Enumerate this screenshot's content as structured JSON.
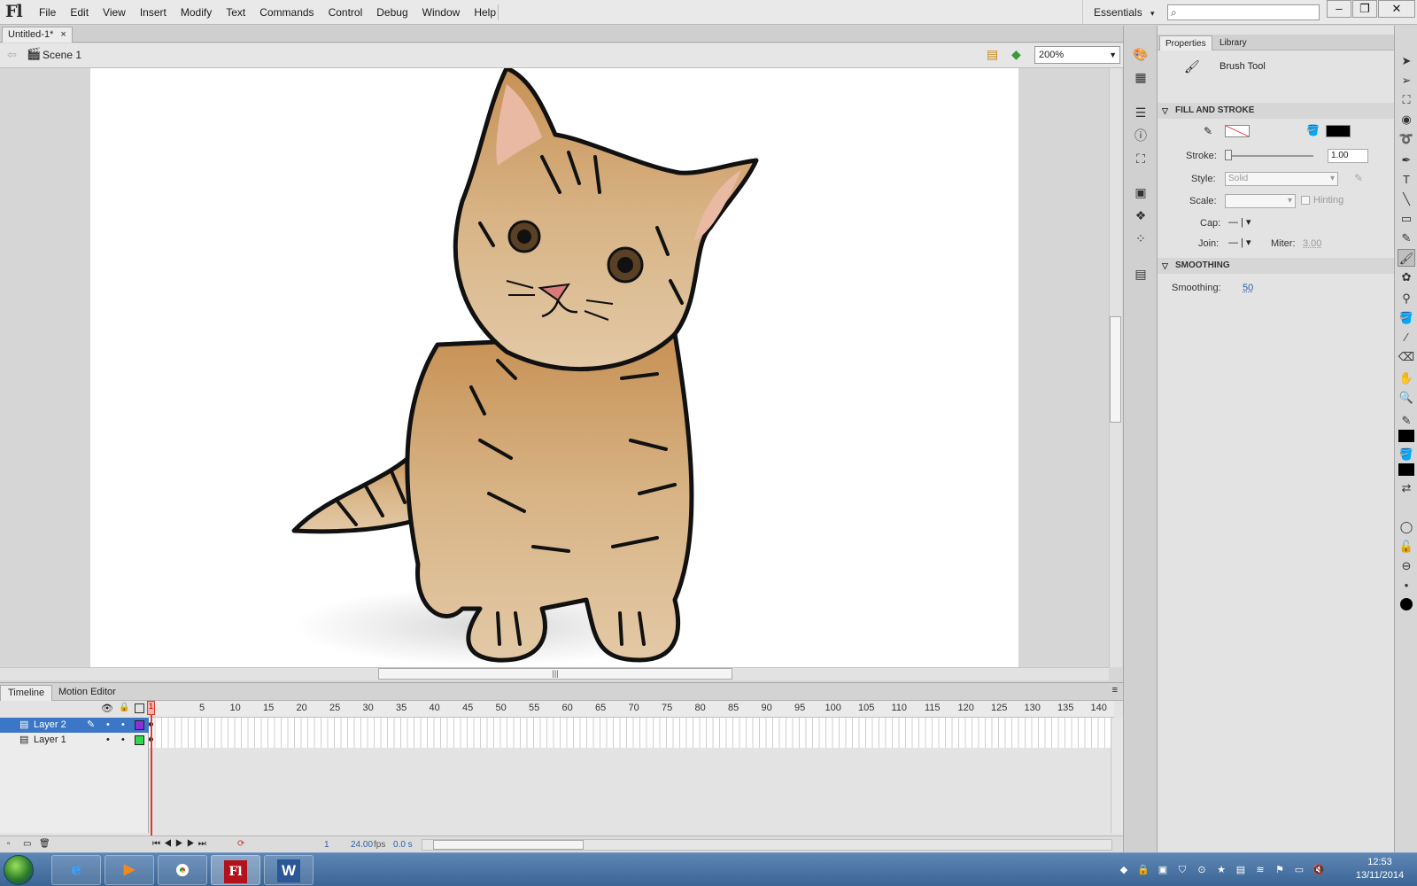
{
  "app": {
    "logo": "Fl"
  },
  "menu": [
    "File",
    "Edit",
    "View",
    "Insert",
    "Modify",
    "Text",
    "Commands",
    "Control",
    "Debug",
    "Window",
    "Help"
  ],
  "workspace": {
    "label": "Essentials",
    "arrow": "▾"
  },
  "window_controls": {
    "minimize": "–",
    "restore": "❐",
    "close": "✕"
  },
  "document": {
    "tab_title": "Untitled-1*",
    "tab_close": "×",
    "scene": "Scene 1",
    "zoom": "200%"
  },
  "timeline": {
    "tabs": [
      "Timeline",
      "Motion Editor"
    ],
    "frame_numbers": [
      "5",
      "10",
      "15",
      "20",
      "25",
      "30",
      "35",
      "40",
      "45",
      "50",
      "55",
      "60",
      "65",
      "70",
      "75",
      "80",
      "85",
      "90",
      "95",
      "100",
      "105",
      "110",
      "115",
      "120",
      "125",
      "130",
      "135",
      "140"
    ],
    "layers": [
      {
        "name": "Layer 2",
        "color": "#8b2fd8",
        "selected": true
      },
      {
        "name": "Layer 1",
        "color": "#2fd84a",
        "selected": false
      }
    ],
    "current_frame": "1",
    "fps_value": "24.00",
    "fps_unit": "fps",
    "time": "0.0 s",
    "playhead_label": "1"
  },
  "properties": {
    "tabs": [
      "Properties",
      "Library"
    ],
    "tool_name": "Brush Tool",
    "sections": {
      "fill_stroke": "FILL AND STROKE",
      "smoothing": "SMOOTHING"
    },
    "stroke_label": "Stroke:",
    "stroke_value": "1.00",
    "style_label": "Style:",
    "style_value": "Solid",
    "scale_label": "Scale:",
    "hinting_label": "Hinting",
    "cap_label": "Cap:",
    "join_label": "Join:",
    "miter_label": "Miter:",
    "miter_value": "3.00",
    "smoothing_label": "Smoothing:",
    "smoothing_value": "50",
    "fill_color": "#000000"
  },
  "taskbar": {
    "time": "12:53",
    "date": "13/11/2014"
  },
  "colors": {
    "accent": "#3c76c6",
    "playhead": "#e0392f"
  }
}
